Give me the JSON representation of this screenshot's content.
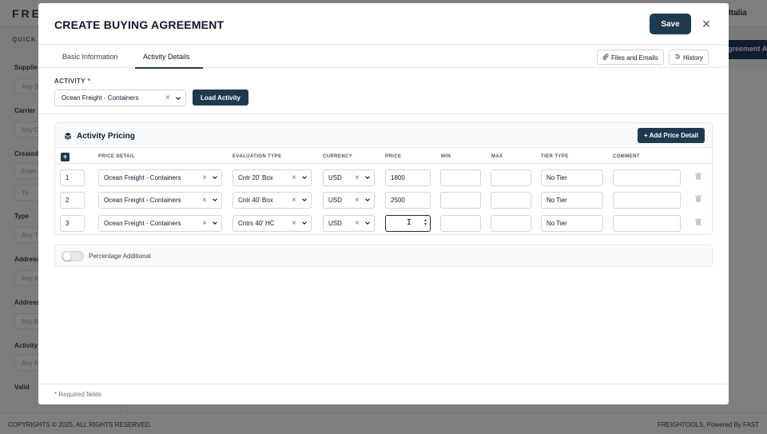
{
  "background": {
    "logo": "FRE",
    "user_label": "Italia",
    "quick_label": "QUICK F",
    "agreement_button": "greement A",
    "filters": [
      {
        "label": "Supplie",
        "placeholder": "Any S"
      },
      {
        "label": "Carrier",
        "placeholder": "Any C"
      },
      {
        "label": "Created",
        "placeholder": "From"
      },
      {
        "label": "",
        "placeholder": "To"
      },
      {
        "label": "Type",
        "placeholder": "Any T"
      },
      {
        "label": "Address",
        "placeholder": "Any A"
      },
      {
        "label": "Address",
        "placeholder": "Any A"
      },
      {
        "label": "Activity",
        "placeholder": "Any A"
      },
      {
        "label": "Valid",
        "placeholder": ""
      }
    ],
    "copyright": "COPYRIGHTS © 2025, ALL RIGHTS RESERVED.",
    "powered_by": "FREIGHTOOLS, Powered By FAST"
  },
  "modal": {
    "title": "CREATE BUYING AGREEMENT",
    "save_label": "Save",
    "close_icon": "×",
    "tabs": [
      {
        "label": "Basic Information",
        "active": false
      },
      {
        "label": "Activity Details",
        "active": true
      }
    ],
    "files_button": "Files and Emails",
    "history_button": "History",
    "activity_label": "ACTIVITY",
    "required_mark": "*",
    "activity_value": "Ocean Freight - Containers",
    "load_activity_label": "Load Activity",
    "pricing": {
      "title": "Activity Pricing",
      "add_button": "Add Price Detail",
      "columns": [
        "PRICE DETAIL",
        "EVALUATION TYPE",
        "CURRENCY",
        "PRICE",
        "MIN",
        "MAX",
        "TIER TYPE",
        "COMMENT"
      ],
      "rows": [
        {
          "index": "1",
          "price_detail": "Ocean Freight - Containers",
          "evaluation_type": "Cntr 20' Box",
          "currency": "USD",
          "price": "1800",
          "min": "",
          "max": "",
          "tier_type": "No Tier",
          "comment": ""
        },
        {
          "index": "2",
          "price_detail": "Ocean Freight - Containers",
          "evaluation_type": "Cntr 40' Box",
          "currency": "USD",
          "price": "2500",
          "min": "",
          "max": "",
          "tier_type": "No Tier",
          "comment": ""
        },
        {
          "index": "3",
          "price_detail": "Ocean Freight - Containers",
          "evaluation_type": "Cntrs 40' HC",
          "currency": "USD",
          "price": "",
          "min": "",
          "max": "",
          "tier_type": "No Tier",
          "comment": ""
        }
      ]
    },
    "percentage_label": "Percentage Additional",
    "required_note": "* Required fields"
  },
  "colors": {
    "primary": "#1e3a4f",
    "required": "#dc2626"
  }
}
